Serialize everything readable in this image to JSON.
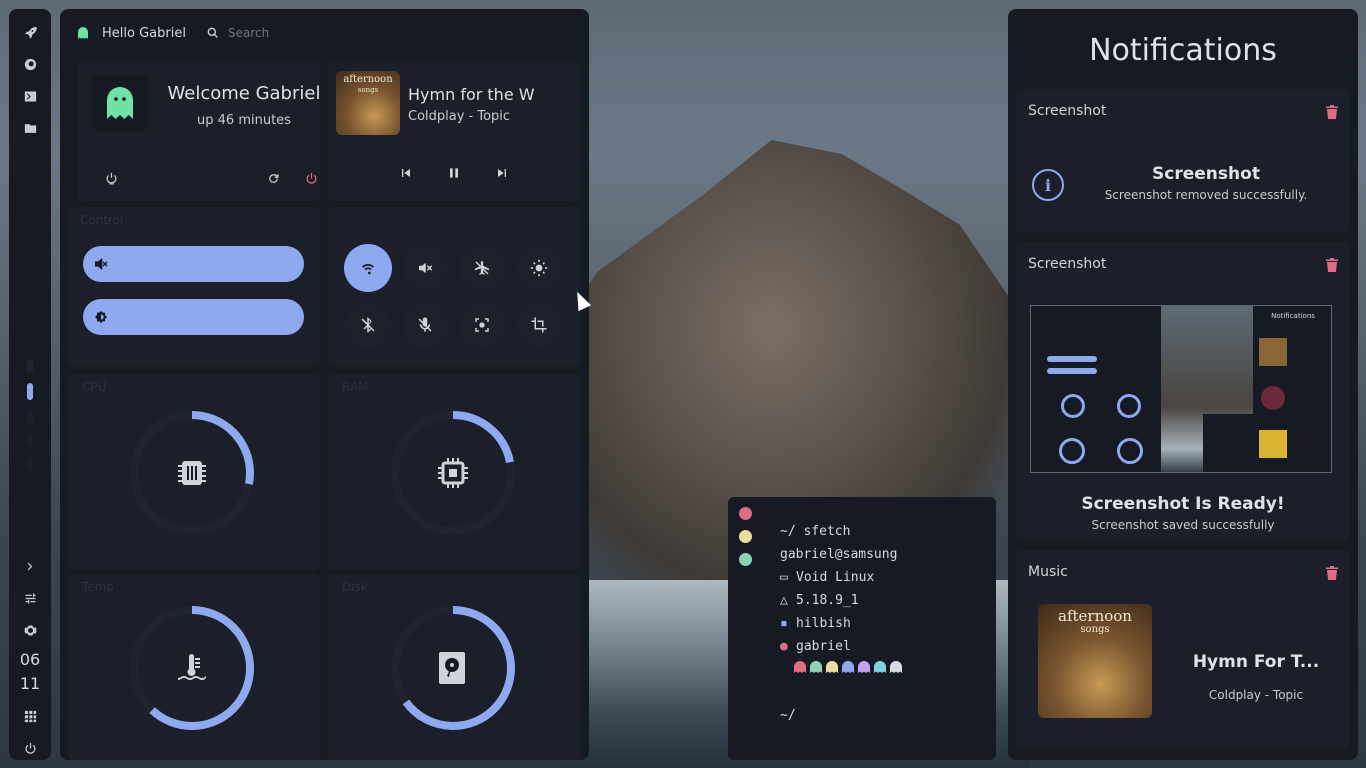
{
  "dock": {
    "icons": [
      "rocket-icon",
      "firefox-icon",
      "terminal-icon",
      "folder-icon"
    ],
    "bottom_icons": [
      "chevron-right-icon",
      "sliders-icon",
      "settings-icon"
    ],
    "clock_hour": "06",
    "clock_minute": "11"
  },
  "topbar": {
    "greeting": "Hello Gabriel",
    "search_placeholder": "Search"
  },
  "welcome": {
    "title": "Welcome Gabriel",
    "uptime": "up 46 minutes"
  },
  "music": {
    "album_text_line1": "afternoon",
    "album_text_line2": "songs",
    "track": "Hymn for the W",
    "artist": "Coldplay - Topic"
  },
  "sections": {
    "control": "Control",
    "cpu": "CPU",
    "ram": "RAM",
    "temp": "Temp",
    "disk": "Disk"
  },
  "gauges": {
    "cpu": 0.28,
    "ram": 0.22,
    "temp": 0.62,
    "disk": 0.65
  },
  "accent": "#8ea9f0",
  "terminal": {
    "dots": [
      "#e06c85",
      "#eadc9b",
      "#8fd1b5"
    ],
    "prompt_cmd": "~/ sfetch",
    "userhost": "gabriel@samsung",
    "os": "Void Linux",
    "kernel": "5.18.9_1",
    "shell": "hilbish",
    "user": "gabriel",
    "ghost_colors": [
      "#e06c85",
      "#8fd1b5",
      "#eadc9b",
      "#8ea9f0",
      "#c9a0f0",
      "#7fd4e0",
      "#d7dae0"
    ],
    "prompt_end": "~/"
  },
  "notifications": {
    "title": "Notifications",
    "items": [
      {
        "app": "Screenshot",
        "heading": "Screenshot",
        "body": "Screenshot removed successfully."
      },
      {
        "app": "Screenshot",
        "heading": "Screenshot Is Ready!",
        "body": "Screenshot saved successfully"
      },
      {
        "app": "Music",
        "heading": "Hymn For T...",
        "body": "Coldplay - Topic",
        "album_text_line1": "afternoon",
        "album_text_line2": "songs"
      }
    ],
    "preview_title": "Notifications"
  }
}
